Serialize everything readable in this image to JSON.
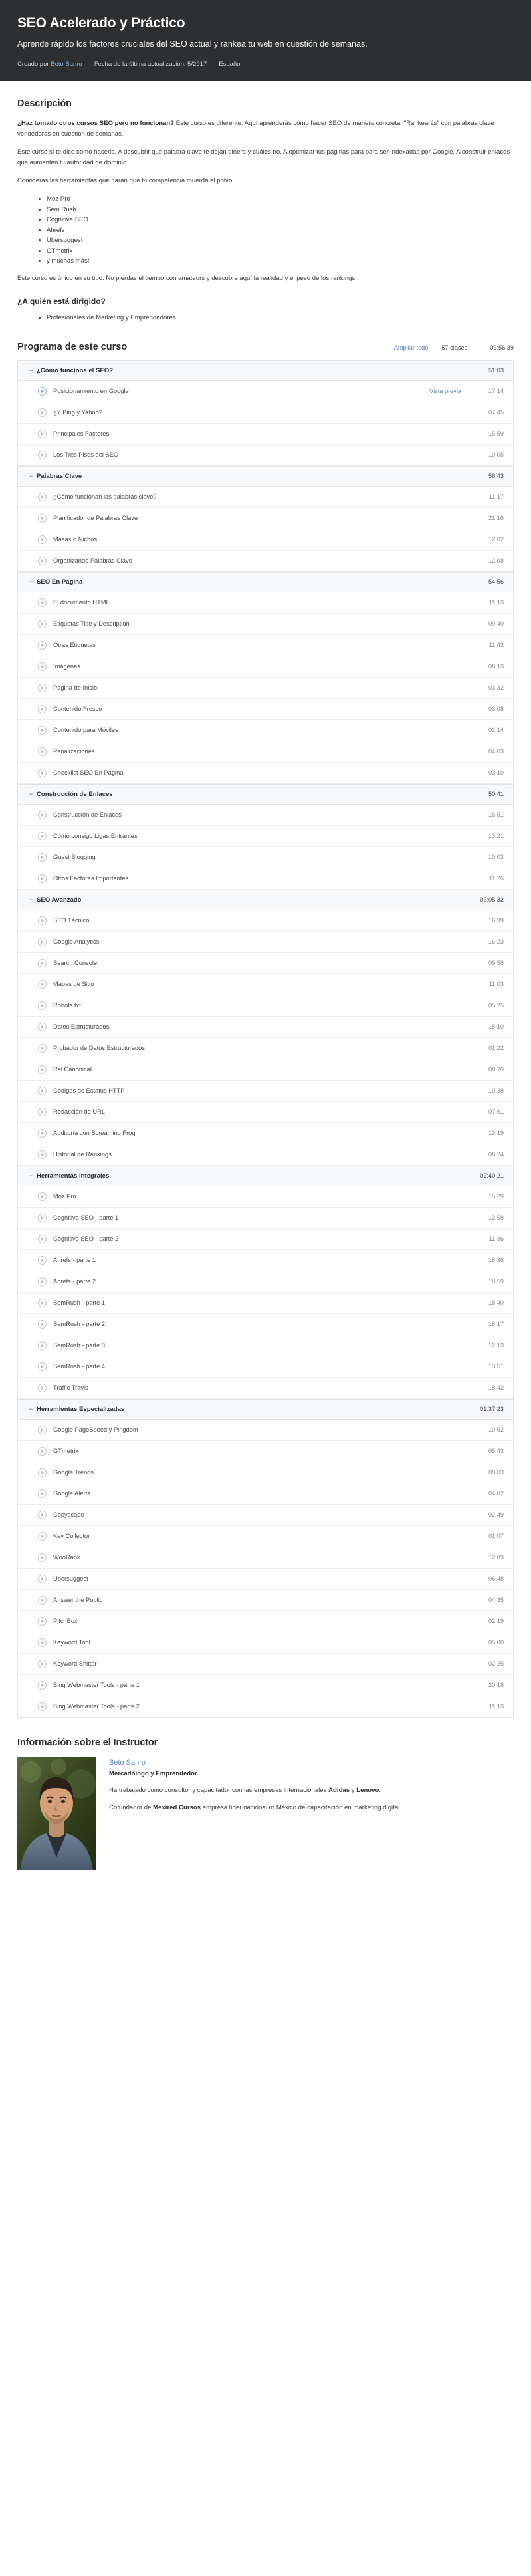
{
  "hero": {
    "title": "SEO Acelerado y Práctico",
    "subtitle": "Aprende rápido los factores cruciales del SEO actual y rankea tu web en cuestión de semanas.",
    "created_by_label": "Creado por",
    "author": "Beto Sanro",
    "last_update": "Fecha de la última actualización: 5/2017",
    "language": "Español"
  },
  "description": {
    "heading": "Descripción",
    "p1_bold": "¿Haz tomado otros cursos SEO pero no funcionan?",
    "p1_rest": " Este curso es diferente. Aquí aprenderás cómo hacer SEO de manera concreta. \"Rankearás\" con palabras clave vendedoras en cuestión de semanas.",
    "p2": "Este curso sí te dice cómo hacerlo. A descubrir qué palabra clave te dejan dinero y cuáles no. A optimizar tus páginas para para ser indexadas por Google. A construir enlaces que aumenten tu autoridad de dominio.",
    "p3": "Conocerás las herramientas que harán que tu competencia muerda el polvo:",
    "tools": [
      "Moz Pro",
      "Sem Rush",
      "Cognitive SEO",
      "Ahrefs",
      "Ubersuggest",
      "GTmetrix",
      "y muchas más!"
    ],
    "p4": "Este curso es único en su tipo. No pierdas el tiempo con amateurs y descubre aquí la realidad y el peso de los rankings.",
    "audience_heading": "¿A quién está dirigido?",
    "audience": [
      "Profesionales de Marketing y Emprendedores."
    ]
  },
  "curriculum": {
    "heading": "Programa de este curso",
    "expand_all": "Ampliar todo",
    "lecture_count": "57 clases",
    "total_length": "09:56:39",
    "collapse_glyph": "–",
    "preview_label": "Vista previa",
    "sections": [
      {
        "name": "¿Cómo funciona el SEO?",
        "duration": "51:03",
        "lectures": [
          {
            "title": "Posicionamiento en Google",
            "duration": "17:14",
            "preview": true
          },
          {
            "title": "¿Y Bing y Yahoo?",
            "duration": "07:45",
            "preview": false
          },
          {
            "title": "Principales Factores",
            "duration": "15:59",
            "preview": false
          },
          {
            "title": "Los Tres Pisos del SEO",
            "duration": "10:05",
            "preview": false
          }
        ]
      },
      {
        "name": "Palabras Clave",
        "duration": "56:43",
        "lectures": [
          {
            "title": "¿Cómo funcionan las palabras clave?",
            "duration": "11:17",
            "preview": false
          },
          {
            "title": "Planificador de Palabras Clave",
            "duration": "21:16",
            "preview": false
          },
          {
            "title": "Masas o Nichos",
            "duration": "12:02",
            "preview": false
          },
          {
            "title": "Organizando Palabras Clave",
            "duration": "12:08",
            "preview": false
          }
        ]
      },
      {
        "name": "SEO En Página",
        "duration": "54:56",
        "lectures": [
          {
            "title": "El documento HTML",
            "duration": "11:13",
            "preview": false
          },
          {
            "title": "Etiquetas Title y Description",
            "duration": "09:40",
            "preview": false
          },
          {
            "title": "Otras Etiquetas",
            "duration": "11:43",
            "preview": false
          },
          {
            "title": "Imágenes",
            "duration": "06:13",
            "preview": false
          },
          {
            "title": "Pagina de Inicio",
            "duration": "03:32",
            "preview": false
          },
          {
            "title": "Contenido Fresco",
            "duration": "03:08",
            "preview": false
          },
          {
            "title": "Contenido para Móviles",
            "duration": "02:14",
            "preview": false
          },
          {
            "title": "Penalizaciones",
            "duration": "04:03",
            "preview": false
          },
          {
            "title": "Checklist SEO En Página",
            "duration": "03:10",
            "preview": false
          }
        ]
      },
      {
        "name": "Construcción de Enlaces",
        "duration": "50:41",
        "lectures": [
          {
            "title": "Construcción de Enlaces",
            "duration": "15:51",
            "preview": false
          },
          {
            "title": "Cómo consigo Ligas Entrantes",
            "duration": "13:21",
            "preview": false
          },
          {
            "title": "Guest Blogging",
            "duration": "10:03",
            "preview": false
          },
          {
            "title": "Otros Factores Importantes",
            "duration": "11:26",
            "preview": false
          }
        ]
      },
      {
        "name": "SEO Avanzado",
        "duration": "02:05:32",
        "lectures": [
          {
            "title": "SEO Técnico",
            "duration": "16:39",
            "preview": false
          },
          {
            "title": "Google Analytics",
            "duration": "16:23",
            "preview": false
          },
          {
            "title": "Search Console",
            "duration": "09:58",
            "preview": false
          },
          {
            "title": "Mapas de Sitio",
            "duration": "11:03",
            "preview": false
          },
          {
            "title": "Robots.txt",
            "duration": "05:25",
            "preview": false
          },
          {
            "title": "Datos Estructurados",
            "duration": "18:10",
            "preview": false
          },
          {
            "title": "Probador de Datos Estructurados",
            "duration": "01:22",
            "preview": false
          },
          {
            "title": "Rel Canonical",
            "duration": "08:20",
            "preview": false
          },
          {
            "title": "Códigos de Estatus HTTP",
            "duration": "10:38",
            "preview": false
          },
          {
            "title": "Redacción de URL",
            "duration": "07:51",
            "preview": false
          },
          {
            "title": "Auditoría con Screaming Frog",
            "duration": "13:19",
            "preview": false
          },
          {
            "title": "Historial de Rankings",
            "duration": "06:24",
            "preview": false
          }
        ]
      },
      {
        "name": "Herramientas Integrales",
        "duration": "02:40:21",
        "lectures": [
          {
            "title": "Moz Pro",
            "duration": "15:29",
            "preview": false
          },
          {
            "title": "Cognitive SEO - parte 1",
            "duration": "13:58",
            "preview": false
          },
          {
            "title": "Cognitive SEO - parte 2",
            "duration": "11:36",
            "preview": false
          },
          {
            "title": "Ahrefs - parte 1",
            "duration": "18:36",
            "preview": false
          },
          {
            "title": "Ahrefs - parte 2",
            "duration": "18:59",
            "preview": false
          },
          {
            "title": "SemRush - parte 1",
            "duration": "18:40",
            "preview": false
          },
          {
            "title": "SemRush - parte 2",
            "duration": "18:17",
            "preview": false
          },
          {
            "title": "SemRush - parte 3",
            "duration": "12:13",
            "preview": false
          },
          {
            "title": "SemRush - parte 4",
            "duration": "13:51",
            "preview": false
          },
          {
            "title": "Traffic Travis",
            "duration": "18:42",
            "preview": false
          }
        ]
      },
      {
        "name": "Herramientas Especializadas",
        "duration": "01:37:23",
        "lectures": [
          {
            "title": "Google PageSpeed y Pingdom",
            "duration": "10:52",
            "preview": false
          },
          {
            "title": "GTmetrix",
            "duration": "05:43",
            "preview": false
          },
          {
            "title": "Google Trends",
            "duration": "08:03",
            "preview": false
          },
          {
            "title": "Google Alerts",
            "duration": "04:02",
            "preview": false
          },
          {
            "title": "Copyscape",
            "duration": "02:49",
            "preview": false
          },
          {
            "title": "Key Collector",
            "duration": "01:07",
            "preview": false
          },
          {
            "title": "WooRank",
            "duration": "12:09",
            "preview": false
          },
          {
            "title": "Ubersuggest",
            "duration": "06:48",
            "preview": false
          },
          {
            "title": "Answer the Public",
            "duration": "04:35",
            "preview": false
          },
          {
            "title": "PitchBox",
            "duration": "02:19",
            "preview": false
          },
          {
            "title": "Keyword Tool",
            "duration": "05:00",
            "preview": false
          },
          {
            "title": "Keyword Shitter",
            "duration": "02:25",
            "preview": false
          },
          {
            "title": "Bing Webmaster Tools - parte 1",
            "duration": "20:18",
            "preview": false
          },
          {
            "title": "Bing Webmaster Tools - parte 2",
            "duration": "11:13",
            "preview": false
          }
        ]
      }
    ]
  },
  "instructor": {
    "heading": "Información sobre el Instructor",
    "name": "Beto Sanro",
    "role": "Mercadólogo y Emprendedor.",
    "bio1_pre": "Ha trabajado como consultor y capacitador con las empresas internacionales ",
    "bio1_b1": "Adidas",
    "bio1_mid": " y ",
    "bio1_b2": "Lenovo",
    "bio1_post": ".",
    "bio2_pre": "Cofundador de ",
    "bio2_b1": "Mexired Cursos",
    "bio2_post": " empresa líder nacional rn México de capacitación en marketing digital."
  },
  "colors": {
    "hero_bg": "#2d2f31",
    "link": "#5a7fa6",
    "accent_link_dark": "#89b8e0",
    "section_bg": "#f7f8fa",
    "border": "#e3e3e3",
    "text": "#3c3b37",
    "muted": "#8a8a8a"
  }
}
